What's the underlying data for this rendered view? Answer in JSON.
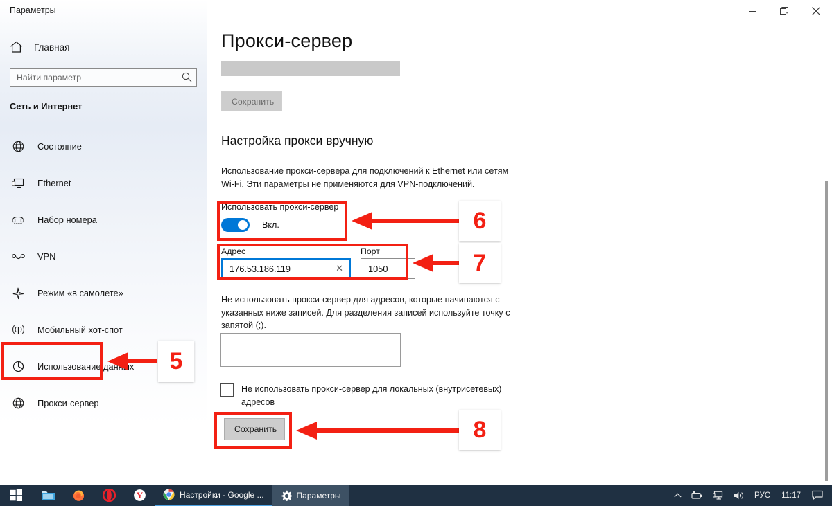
{
  "window": {
    "title": "Параметры",
    "controls": {
      "minimize": "minimize",
      "restore": "restore",
      "close": "close"
    }
  },
  "sidebar": {
    "home": {
      "label": "Главная",
      "icon": "home-icon"
    },
    "search": {
      "placeholder": "Найти параметр",
      "value": "",
      "icon": "search-icon"
    },
    "section_title": "Сеть и Интернет",
    "items": [
      {
        "label": "Состояние",
        "icon": "globe-status-icon",
        "selected": false
      },
      {
        "label": "Ethernet",
        "icon": "ethernet-icon",
        "selected": false
      },
      {
        "label": "Набор номера",
        "icon": "dialup-icon",
        "selected": false
      },
      {
        "label": "VPN",
        "icon": "vpn-icon",
        "selected": false
      },
      {
        "label": "Режим «в самолете»",
        "icon": "airplane-icon",
        "selected": false
      },
      {
        "label": "Мобильный хот-спот",
        "icon": "hotspot-icon",
        "selected": false
      },
      {
        "label": "Использование данных",
        "icon": "data-usage-icon",
        "selected": false
      },
      {
        "label": "Прокси-сервер",
        "icon": "proxy-globe-icon",
        "selected": true
      }
    ]
  },
  "main": {
    "page_title": "Прокси-сервер",
    "redacted_bar": "",
    "top_save_label": "Сохранить",
    "manual_setup_heading": "Настройка прокси вручную",
    "manual_description": "Использование прокси-сервера для подключений к Ethernet или сетям Wi-Fi. Эти параметры не применяются для VPN-подключений.",
    "use_proxy": {
      "label": "Использовать прокси-сервер",
      "state": "Вкл.",
      "on": true
    },
    "address_field": {
      "label": "Адрес",
      "value": "176.53.186.119",
      "clear_icon": "close-icon"
    },
    "port_field": {
      "label": "Порт",
      "value": "1050"
    },
    "exceptions_description": "Не использовать прокси-сервер для адресов, которые начинаются с указанных ниже записей. Для разделения записей используйте точку с запятой (;).",
    "exceptions_value": "",
    "exceptions_placeholder": "",
    "local_bypass": {
      "label": "Не использовать прокси-сервер для локальных (внутрисетевых) адресов",
      "checked": false
    },
    "bottom_save_label": "Сохранить"
  },
  "annotations": {
    "accent_color": "#f32013",
    "steps": [
      {
        "number": "5",
        "target": "sidebar-item-proxy"
      },
      {
        "number": "6",
        "target": "use-proxy-toggle"
      },
      {
        "number": "7",
        "target": "address-port-fields"
      },
      {
        "number": "8",
        "target": "bottom-save-button"
      }
    ]
  },
  "taskbar": {
    "start_label": "Пуск",
    "pinned": [
      {
        "name": "file-explorer-icon",
        "label": "Проводник"
      },
      {
        "name": "firefox-icon",
        "label": "Firefox"
      },
      {
        "name": "opera-icon",
        "label": "Opera"
      },
      {
        "name": "yandex-browser-icon",
        "label": "Яндекс.Браузер"
      }
    ],
    "tasks": [
      {
        "name": "chrome-task",
        "icon": "chrome-icon",
        "label": "Настройки - Google ...",
        "active": false
      },
      {
        "name": "settings-task",
        "icon": "gear-icon",
        "label": "Параметры",
        "active": true
      }
    ],
    "tray": {
      "chevron": "chevron-up-icon",
      "icons": [
        "device-icon",
        "network-icon",
        "volume-icon"
      ],
      "language": "РУС",
      "clock": "11:17",
      "action_center": "notification-icon"
    }
  }
}
